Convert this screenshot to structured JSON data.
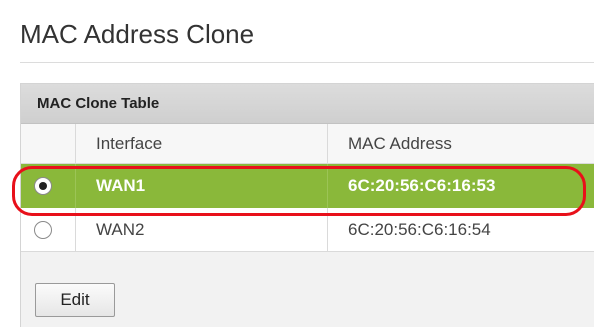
{
  "page": {
    "title": "MAC Address Clone"
  },
  "table": {
    "caption": "MAC Clone Table",
    "columns": [
      "",
      "Interface",
      "MAC Address"
    ],
    "rows": [
      {
        "interface": "WAN1",
        "mac": "6C:20:56:C6:16:53",
        "selected": true
      },
      {
        "interface": "WAN2",
        "mac": "6C:20:56:C6:16:54",
        "selected": false
      }
    ]
  },
  "actions": {
    "edit_label": "Edit"
  },
  "colors": {
    "selected_row": "#8ab83a",
    "highlight_ring": "#e8101a",
    "header_bg": "#d6d6d6"
  }
}
